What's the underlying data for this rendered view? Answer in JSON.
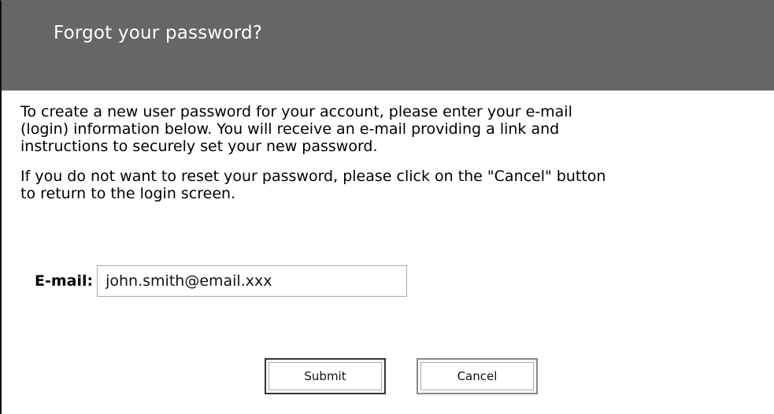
{
  "header": {
    "title": "Forgot your password?"
  },
  "content": {
    "paragraph1": [
      "To create a new user password for your account, please enter your e-mail",
      "(login) information below. You will receive an e-mail providing a link and",
      "instructions to securely set your new password."
    ],
    "paragraph2": [
      "If you do not want to reset your password, please click on the \"Cancel\" button",
      "to return to the login screen."
    ]
  },
  "form": {
    "email_label": "E-mail:",
    "email_value": "john.smith@email.xxx"
  },
  "buttons": {
    "submit_label": "Submit",
    "cancel_label": "Cancel"
  },
  "colors": {
    "header_bg": "#666666",
    "header_text": "#ffffff"
  }
}
